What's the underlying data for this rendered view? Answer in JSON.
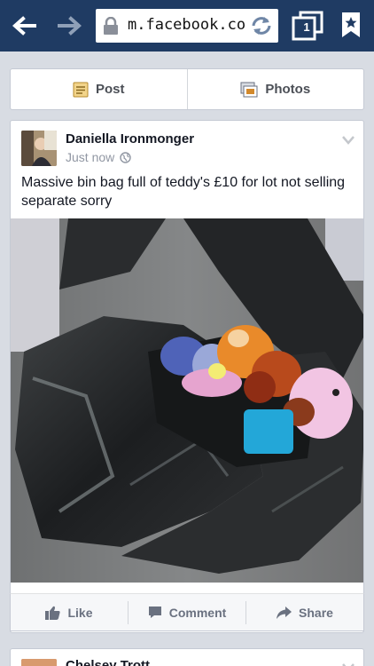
{
  "browser": {
    "url": "m.facebook.co",
    "tab_count": "1"
  },
  "composer": {
    "post_label": "Post",
    "photos_label": "Photos"
  },
  "post": {
    "author": "Daniella Ironmonger",
    "time": "Just now",
    "text": "Massive bin bag full of teddy's £10 for lot not selling separate sorry"
  },
  "actions": {
    "like": "Like",
    "comment": "Comment",
    "share": "Share"
  },
  "next_post": {
    "author": "Chelsey Trott"
  },
  "colors": {
    "browser_bar": "#1f3b63",
    "page_bg": "#d8dce3",
    "link_text": "#141823",
    "muted": "#9197a3"
  }
}
